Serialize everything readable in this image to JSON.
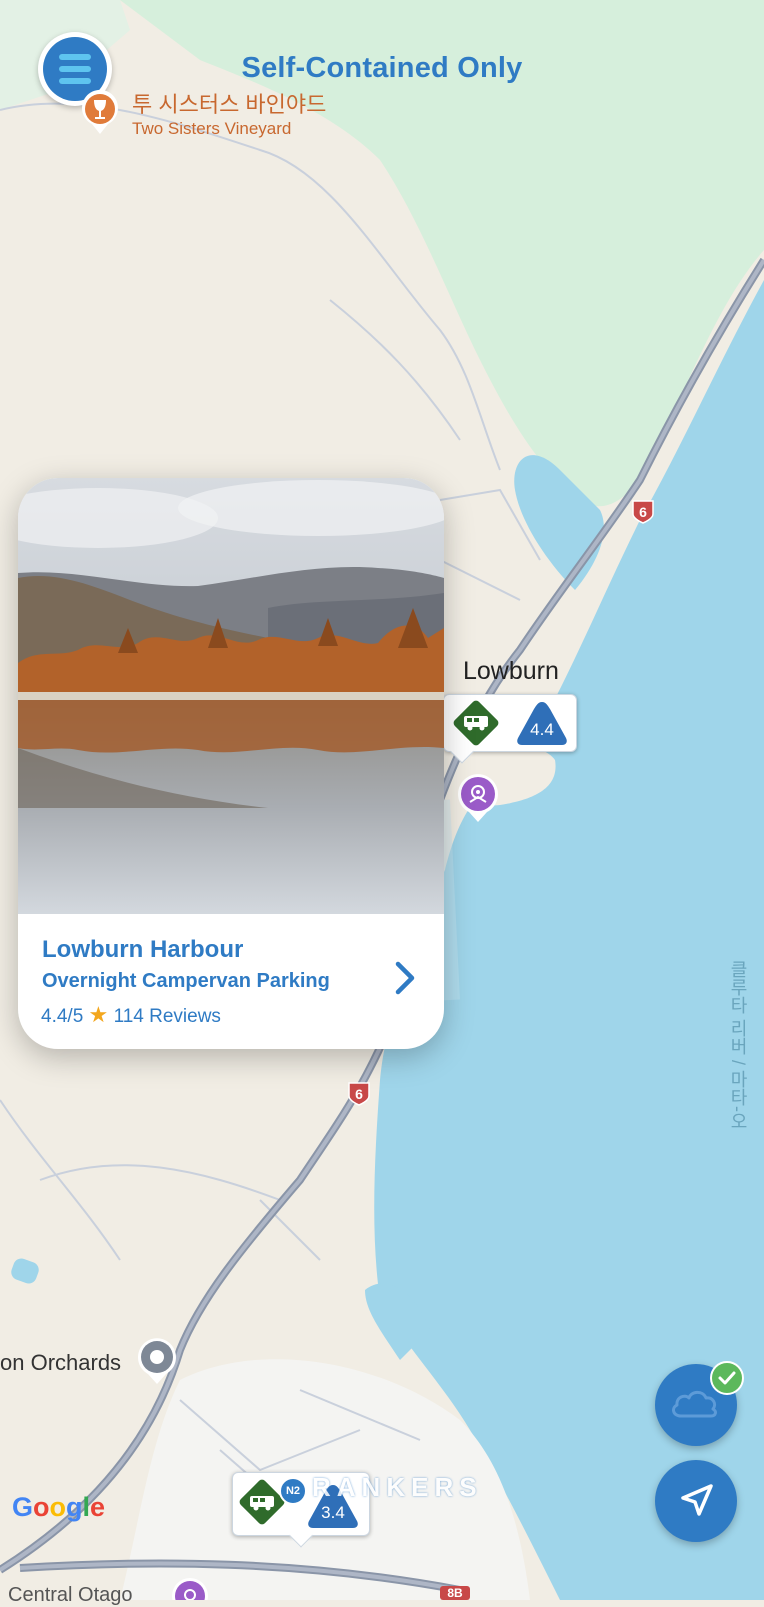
{
  "header": {
    "filter_title": "Self-Contained Only"
  },
  "menu": {
    "icon": "hamburger-menu-icon"
  },
  "map": {
    "poi": {
      "name_ko": "투 시스터스 바인야드",
      "name_en": "Two Sisters Vineyard",
      "icon": "wine-glass-icon"
    },
    "town": "Lowburn",
    "orchards": "on Orchards",
    "central": "Central Otago",
    "river": "클루타 리버 / 마타-오",
    "highway_labels": [
      "6",
      "6",
      "8B"
    ],
    "lowburn_marker": {
      "rating": "4.4"
    },
    "bottom_marker": {
      "rating": "3.4",
      "badge": "N2"
    },
    "google": "Google",
    "watermark": "RANKERS"
  },
  "card": {
    "title": "Lowburn Harbour",
    "subtitle": "Overnight Campervan Parking",
    "rating_value": "4.4/5",
    "reviews": "114 Reviews"
  },
  "buttons": {
    "weather_icon": "cloud-icon",
    "location_icon": "navigation-arrow-icon"
  },
  "colors": {
    "accent": "#2f7bc4",
    "lake": "#9fd5ea",
    "land": "#f1ede4",
    "park": "#d6efdc",
    "marker_green": "#2f6b2b",
    "star": "#f3a71e"
  }
}
